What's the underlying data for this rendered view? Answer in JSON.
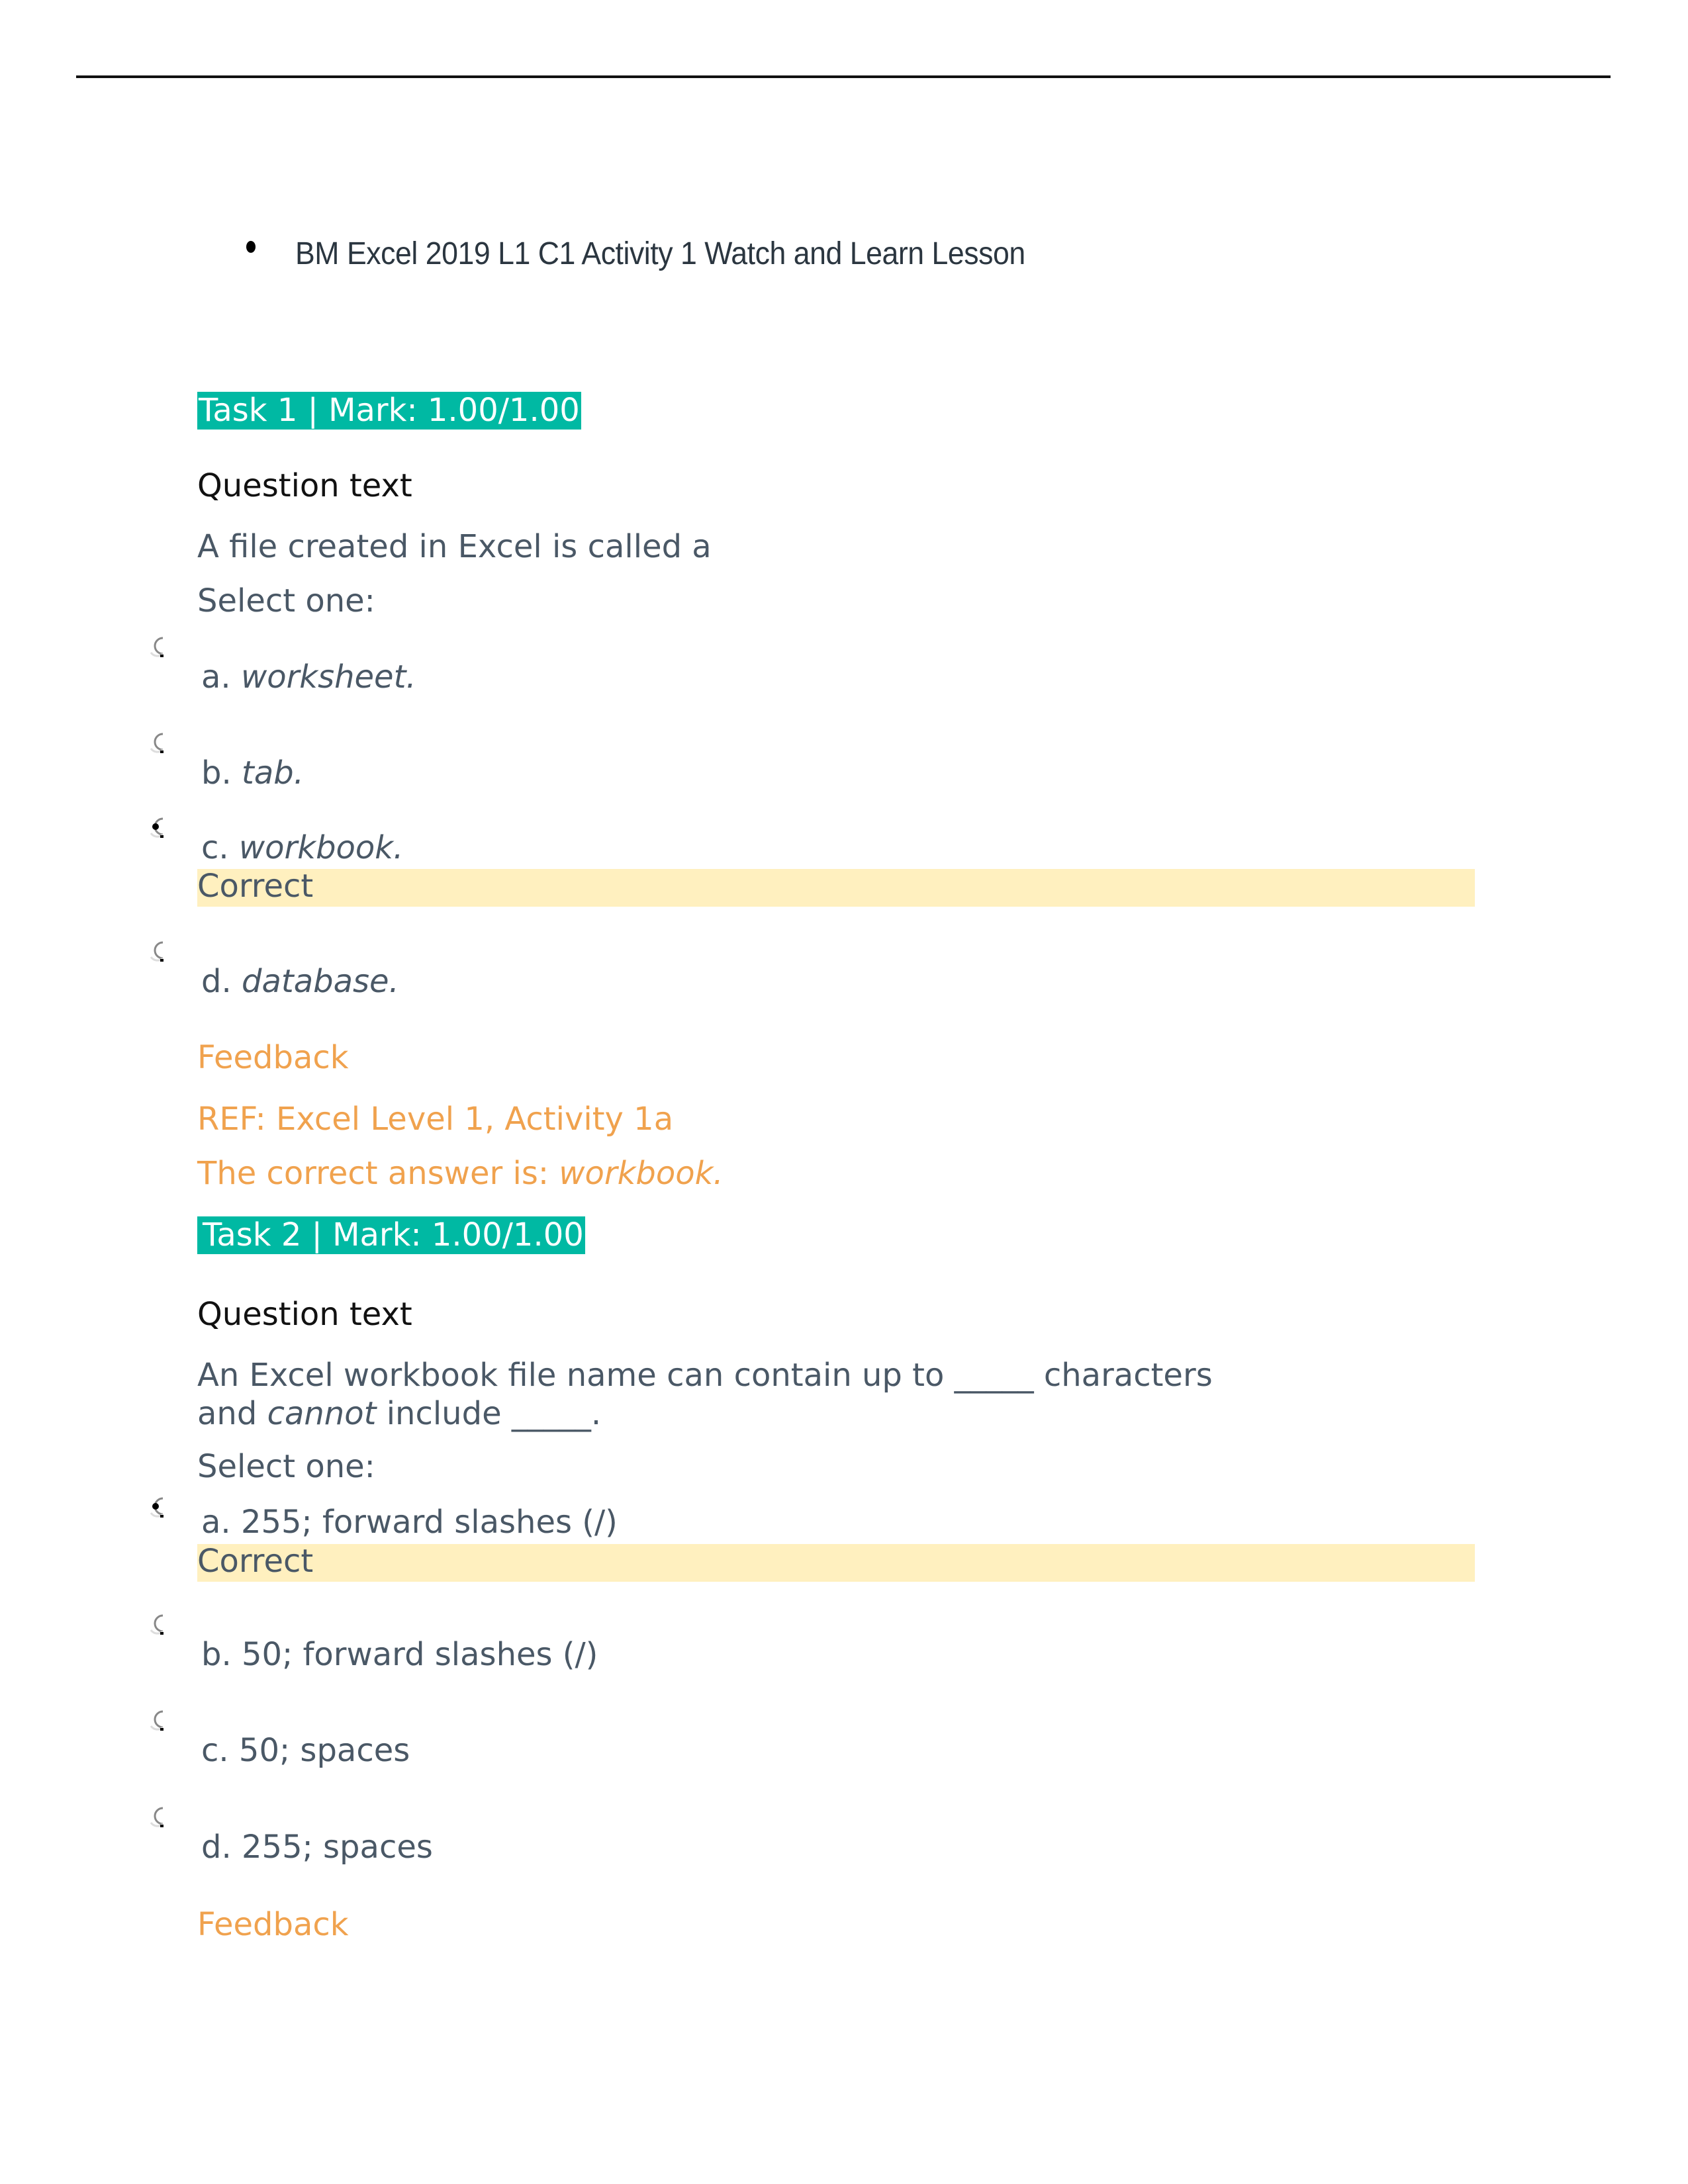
{
  "document": {
    "title": "BM Excel 2019 L1 C1 Activity 1 Watch and Learn Lesson"
  },
  "colors": {
    "task_badge": "#00b9a3",
    "correct_highlight": "#fff0bf",
    "feedback_text": "#f0a24e",
    "body_text": "#4a5866"
  },
  "tasks": [
    {
      "header": "Task 1 | Mark: 1.00/1.00",
      "question_label": "Question text",
      "question": "A file created in Excel is called a",
      "select_prompt": "Select one:",
      "options": [
        {
          "letter": "a.",
          "text": "worksheet.",
          "italic": true,
          "selected": false
        },
        {
          "letter": "b.",
          "text": "tab.",
          "italic": true,
          "selected": false
        },
        {
          "letter": "c.",
          "text": "workbook.",
          "italic": true,
          "selected": true,
          "status": "Correct"
        },
        {
          "letter": "d.",
          "text": "database.",
          "italic": true,
          "selected": false
        }
      ],
      "feedback_label": "Feedback",
      "reference": "REF: Excel Level 1, Activity 1a",
      "correct_answer_prefix": "The correct answer is:",
      "correct_answer": "workbook."
    },
    {
      "header": "Task 2 | Mark: 1.00/1.00",
      "question_label": "Question text",
      "question_line1_pre": "An Excel workbook file name can contain up to _____ characters",
      "question_line2_pre": "and",
      "question_line2_italic": "cannot",
      "question_line2_post": "include _____.",
      "select_prompt": "Select one:",
      "options": [
        {
          "letter": "a.",
          "text": "255; forward slashes (/)",
          "selected": true,
          "status": "Correct"
        },
        {
          "letter": "b.",
          "text": "50; forward slashes (/)",
          "selected": false
        },
        {
          "letter": "c.",
          "text": "50; spaces",
          "selected": false
        },
        {
          "letter": "d.",
          "text": "255; spaces",
          "selected": false
        }
      ],
      "feedback_label": "Feedback"
    }
  ]
}
